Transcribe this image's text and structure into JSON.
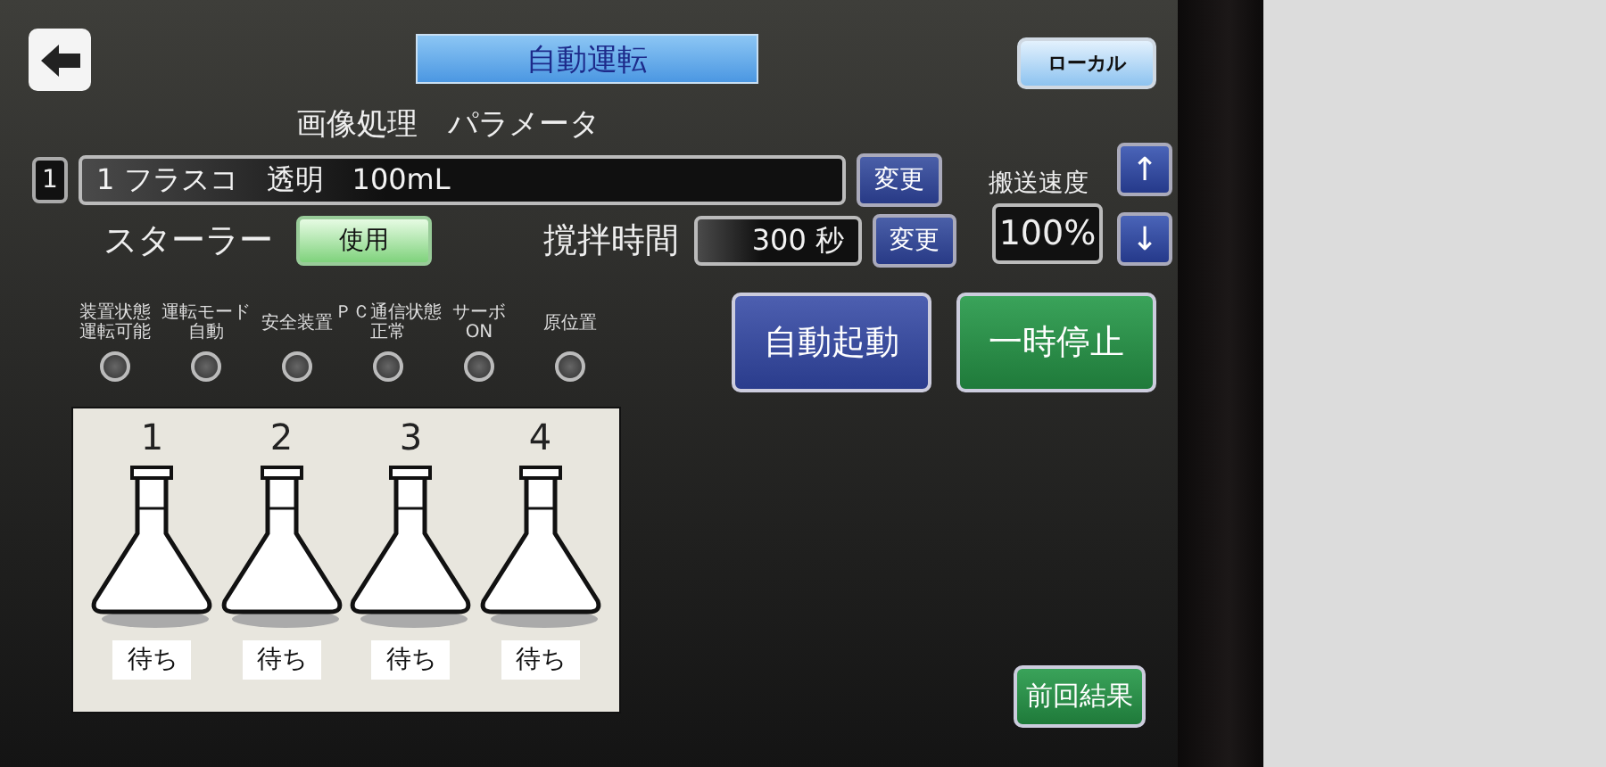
{
  "title": "自動運転",
  "mode_button": "ローカル",
  "section_title": "画像処理　パラメータ",
  "recipe": {
    "index": "1",
    "value": "1 フラスコ　透明　100mL",
    "change_button": "変更"
  },
  "stirrer": {
    "label": "スターラー",
    "button": "使用",
    "on": true
  },
  "stir_time": {
    "label": "撹拌時間",
    "value": "300 秒",
    "change_button": "変更"
  },
  "speed": {
    "label": "搬送速度",
    "value": "100%",
    "up": "↑",
    "down": "↓"
  },
  "indicators": [
    {
      "lines": [
        "装置状態",
        "運転可能"
      ],
      "on": false
    },
    {
      "lines": [
        "運転モード",
        "自動"
      ],
      "on": false
    },
    {
      "lines": [
        "安全装置"
      ],
      "on": false
    },
    {
      "lines": [
        "ＰＣ通信状態",
        "正常"
      ],
      "on": false
    },
    {
      "lines": [
        "サーボ",
        "ON"
      ],
      "on": false
    },
    {
      "lines": [
        "原位置"
      ],
      "on": false
    }
  ],
  "actions": [
    {
      "label": "自動起動",
      "kind": "start"
    },
    {
      "label": "一時停止",
      "kind": "pause"
    }
  ],
  "flasks": [
    {
      "number": "1",
      "status": "待ち"
    },
    {
      "number": "2",
      "status": "待ち"
    },
    {
      "number": "3",
      "status": "待ち"
    },
    {
      "number": "4",
      "status": "待ち"
    }
  ],
  "previous_result_button": "前回結果"
}
